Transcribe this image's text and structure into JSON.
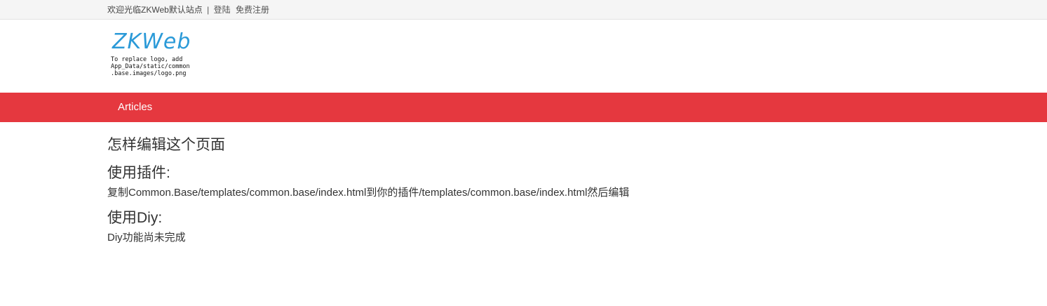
{
  "topbar": {
    "welcome": "欢迎光临ZKWeb默认站点",
    "separator": "|",
    "login": "登陆",
    "register": "免费注册"
  },
  "logo": {
    "word": "ZKWeb",
    "note": "To replace logo, add\nApp_Data/static/common\n.base.images/logo.png"
  },
  "nav": {
    "items": [
      {
        "label": "Articles"
      }
    ],
    "color": "#e5383f"
  },
  "main": {
    "title": "怎样编辑这个页面",
    "sections": [
      {
        "heading": "使用插件:",
        "text": "复制Common.Base/templates/common.base/index.html到你的插件/templates/common.base/index.html然后编辑"
      },
      {
        "heading": "使用Diy:",
        "text": "Diy功能尚未完成"
      }
    ]
  }
}
